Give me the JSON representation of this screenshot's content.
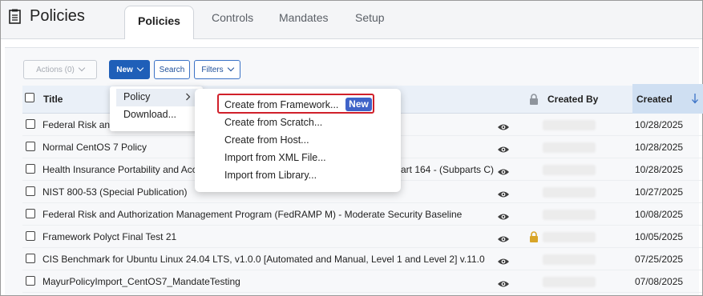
{
  "app": {
    "title": "Policies"
  },
  "tabs": [
    {
      "label": "Policies",
      "active": true
    },
    {
      "label": "Controls"
    },
    {
      "label": "Mandates"
    },
    {
      "label": "Setup"
    }
  ],
  "toolbar": {
    "actions_label": "Actions (0)",
    "new_label": "New",
    "search_label": "Search",
    "filters_label": "Filters"
  },
  "table": {
    "columns": {
      "title": "Title",
      "created_by": "Created By",
      "created": "Created"
    },
    "rows": [
      {
        "title": "Federal Risk an",
        "created": "10/28/2025",
        "locked": false
      },
      {
        "title": "Normal CentOS 7 Policy",
        "created": "10/28/2025",
        "locked": false
      },
      {
        "title": "Health Insurance Portability and Acc",
        "title_end": "art 164 - (Subparts C)",
        "created": "10/28/2025",
        "locked": false
      },
      {
        "title": "NIST 800-53 (Special Publication)",
        "created": "10/27/2025",
        "locked": false
      },
      {
        "title": "Federal Risk and Authorization Management Program (FedRAMP M) - Moderate Security Baseline",
        "created": "10/08/2025",
        "locked": false
      },
      {
        "title": "Framework Polyct Final Test 21",
        "created": "10/05/2025",
        "locked": true
      },
      {
        "title": "CIS Benchmark for Ubuntu Linux 24.04 LTS, v1.0.0 [Automated and Manual, Level 1 and Level 2] v.11.0",
        "created": "07/25/2025",
        "locked": false
      },
      {
        "title": "MayurPolicyImport_CentOS7_MandateTesting",
        "created": "07/08/2025",
        "locked": false
      }
    ]
  },
  "new_menu": {
    "items": [
      {
        "label": "Policy",
        "has_submenu": true
      },
      {
        "label": "Download..."
      }
    ]
  },
  "policy_submenu": {
    "items": [
      {
        "label": "Create from Framework...",
        "badge": "New"
      },
      {
        "label": "Create from Scratch..."
      },
      {
        "label": "Create from Host..."
      },
      {
        "label": "Import from XML File..."
      },
      {
        "label": "Import from Library..."
      }
    ]
  },
  "colors": {
    "primary": "#1f5fb8",
    "badge": "#3f63c8",
    "highlight_box": "#d0202a",
    "lock": "#d8a528",
    "sorted_column": "#cfdff2"
  },
  "icons": [
    "document-icon",
    "chevron-down-icon",
    "lock-icon",
    "sort-down-arrow-icon",
    "eye-icon",
    "chevron-right-icon"
  ]
}
